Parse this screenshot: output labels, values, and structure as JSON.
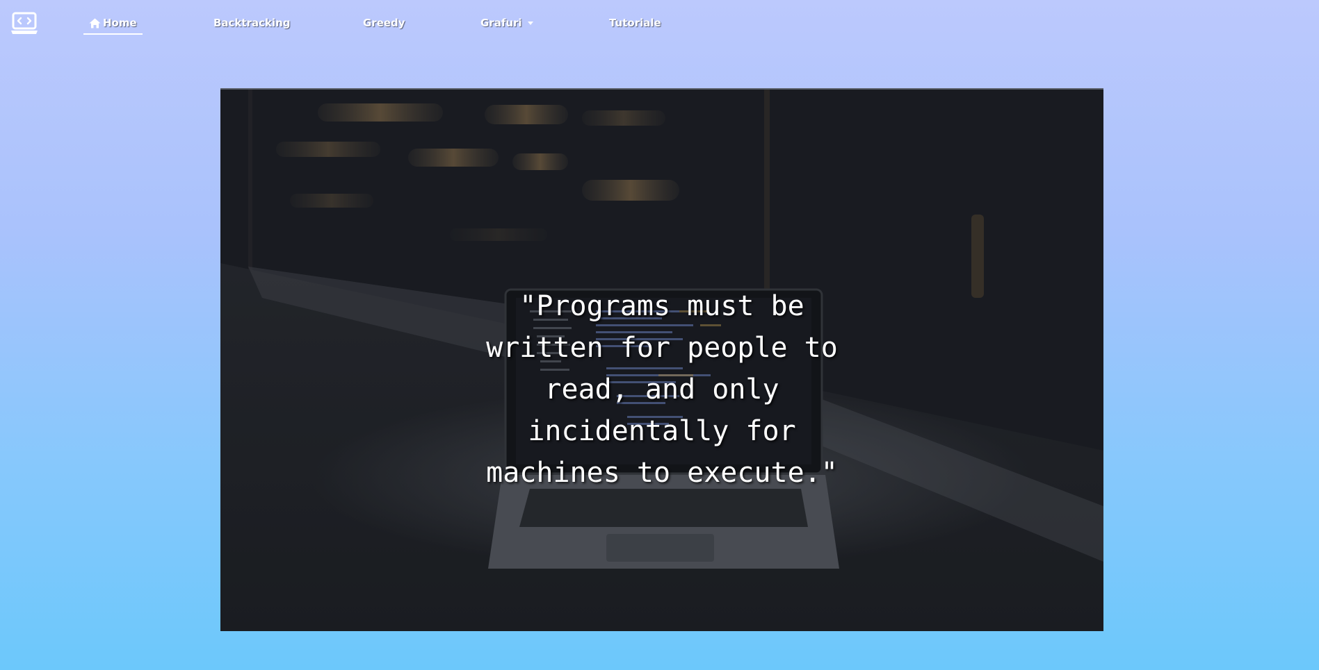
{
  "nav": {
    "brand_icon": "laptop-code-icon",
    "items": [
      {
        "label": "Home",
        "icon": "home-icon",
        "active": true
      },
      {
        "label": "Backtracking"
      },
      {
        "label": "Greedy"
      },
      {
        "label": "Grafuri",
        "dropdown": true
      },
      {
        "label": "Tutoriale"
      }
    ]
  },
  "hero": {
    "background": "laptop-on-table-photo",
    "quote_lines": [
      "\"Programs must be",
      "written for people to",
      "read, and only",
      "incidentally for",
      "machines to execute.\""
    ]
  },
  "colors": {
    "gradient_top": "#bcc9fd",
    "gradient_bottom": "#6cc8fb",
    "nav_text": "#ffffff"
  }
}
